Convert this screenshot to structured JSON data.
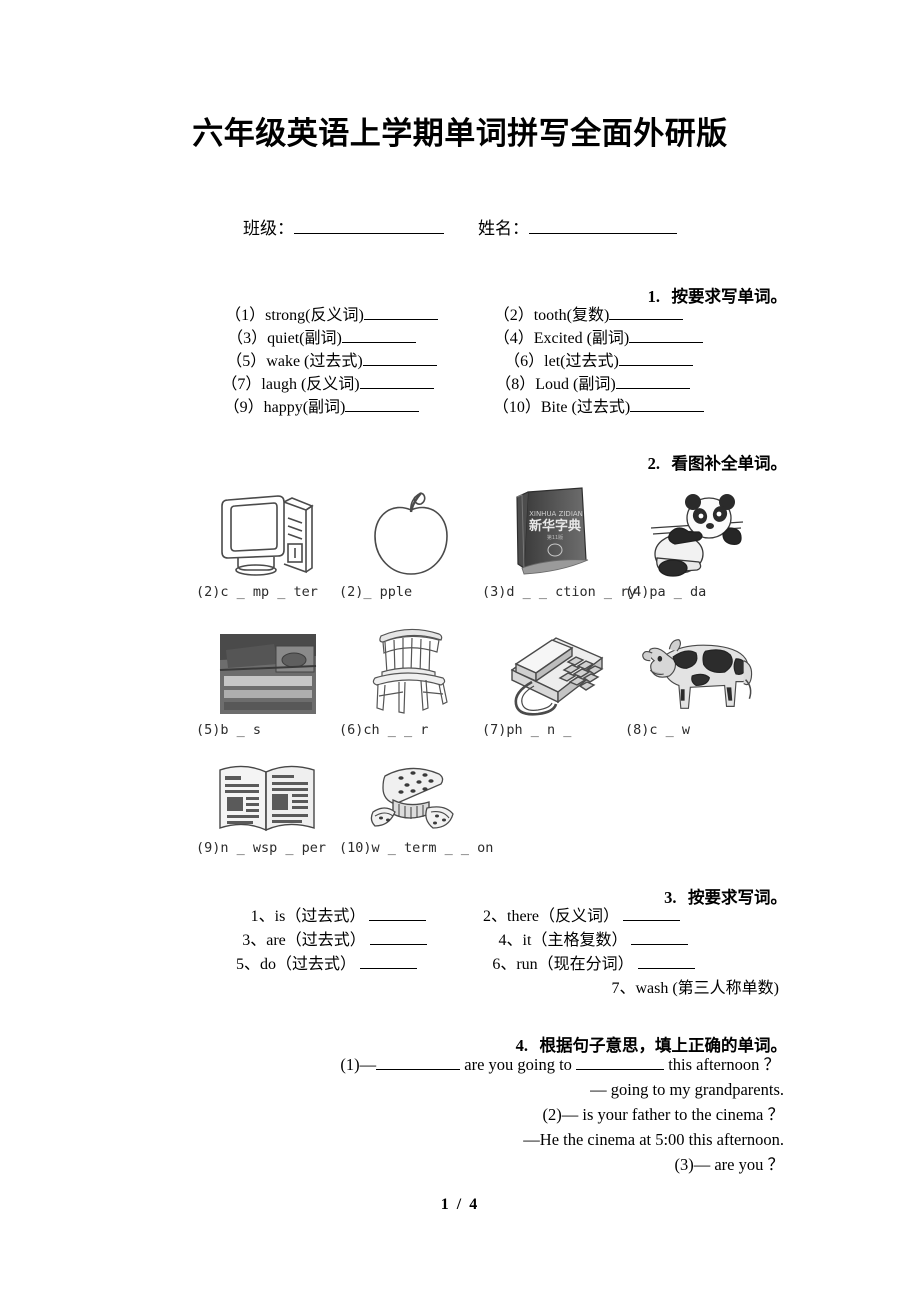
{
  "document": {
    "title": "六年级英语上学期单词拼写全面外研版",
    "footer": "1 / 4"
  },
  "header_fields": {
    "class_label": "班级：",
    "name_label": "姓名："
  },
  "section1": {
    "heading_number": "1.",
    "heading_text": "按要求写单词。",
    "items": [
      {
        "num": "（1）",
        "word": "strong(反义词)"
      },
      {
        "num": "（2）",
        "word": "tooth(复数)"
      },
      {
        "num": "（3）",
        "word": "quiet(副词)"
      },
      {
        "num": "（4）",
        "word": "Excited (副词)"
      },
      {
        "num": "（5）",
        "word": "wake (过去式)"
      },
      {
        "num": "（6）",
        "word": "let(过去式)"
      },
      {
        "num": "（7）",
        "word": "laugh (反义词)"
      },
      {
        "num": "（8）",
        "word": "Loud (副词)"
      },
      {
        "num": "（9）",
        "word": "happy(副词)"
      },
      {
        "num": "（10）",
        "word": "Bite (过去式)"
      }
    ]
  },
  "section2": {
    "heading_number": "2.",
    "heading_text": "看图补全单词。",
    "pictures": [
      {
        "label": "(2)c _ mp _ ter",
        "icon": "computer-icon"
      },
      {
        "label": "(2)_ pple",
        "icon": "apple-icon"
      },
      {
        "label": "(3)d _ _ ction _ ry",
        "icon": "dictionary-icon"
      },
      {
        "label": "(4)pa _ da",
        "icon": "panda-icon"
      },
      {
        "label": "(5)b _ s",
        "icon": "bus-icon"
      },
      {
        "label": "(6)ch _ _ r",
        "icon": "chair-icon"
      },
      {
        "label": "(7)ph _ n _",
        "icon": "telephone-icon"
      },
      {
        "label": "(8)c _ w",
        "icon": "cow-icon"
      },
      {
        "label": "(9)n _ wsp _ per",
        "icon": "newspaper-icon"
      },
      {
        "label": "(10)w _ term _ _ on",
        "icon": "watermelon-icon"
      }
    ]
  },
  "section3": {
    "heading_number": "3.",
    "heading_text": "按要求写词。",
    "items": [
      {
        "text": "1、is（过去式）"
      },
      {
        "text": "2、there（反义词）"
      },
      {
        "text": "3、are（过去式）"
      },
      {
        "text": "4、it（主格复数）"
      },
      {
        "text": "5、do（过去式）"
      },
      {
        "text": "6、run（现在分词）"
      },
      {
        "text": "7、wash (第三人称单数)"
      }
    ]
  },
  "section4": {
    "heading_number": "4.",
    "heading_text": "根据句子意思，填上正确的单词。",
    "lines": [
      {
        "prefix": "(1)—",
        "mid": "are you going to",
        "suffix": "this afternoon ？"
      },
      {
        "text": "—  going to  my grandparents."
      },
      {
        "text": "(2)—  is your father  to the cinema ？"
      },
      {
        "text": "—He  the cinema at 5:00 this afternoon."
      },
      {
        "text": "(3)—  are  you  ？"
      }
    ]
  }
}
